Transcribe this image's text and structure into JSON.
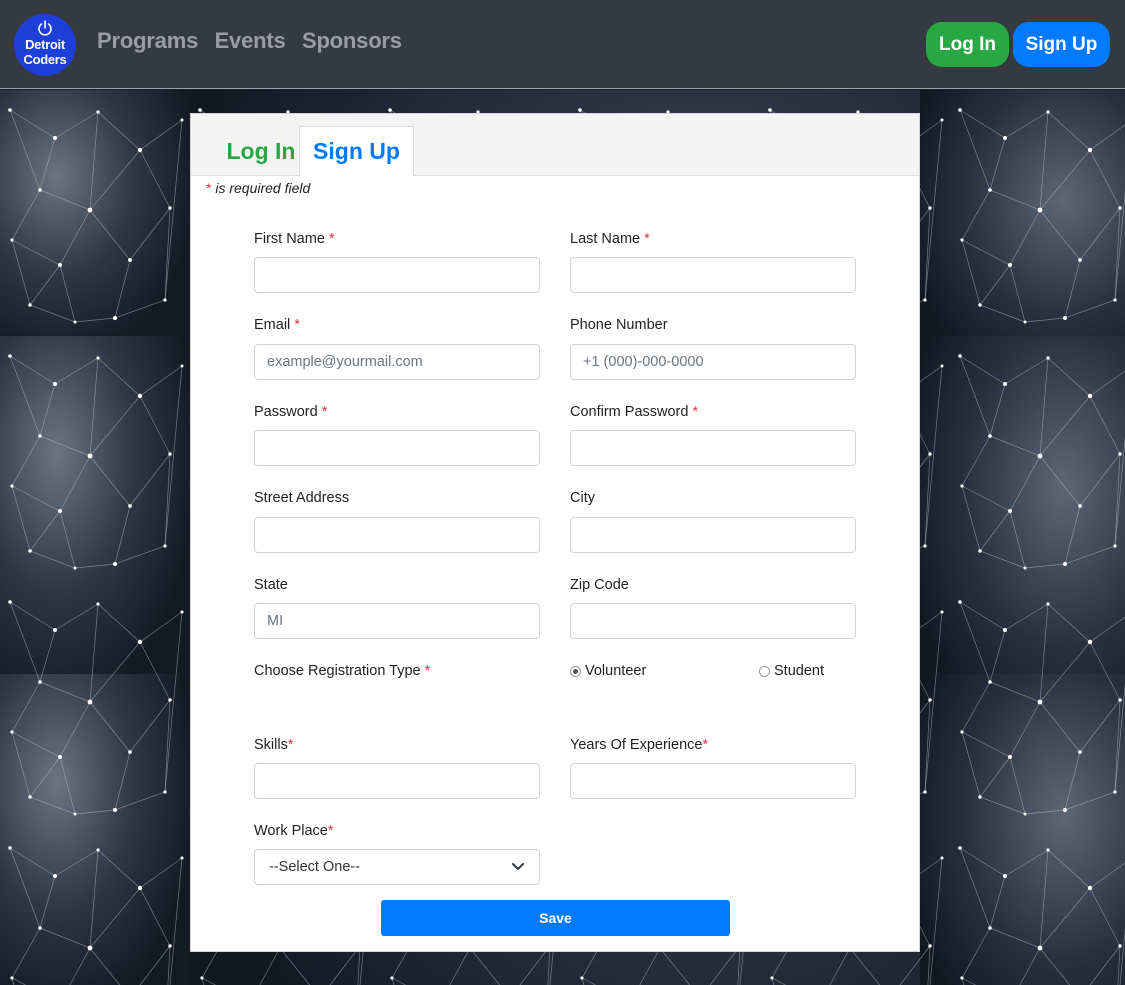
{
  "brand": {
    "line1": "Detroit",
    "line2": "Coders"
  },
  "nav": {
    "links": [
      "Programs",
      "Events",
      "Sponsors"
    ],
    "login_label": "Log In",
    "signup_label": "Sign Up"
  },
  "tabs": {
    "login": "Log In",
    "signup": "Sign Up"
  },
  "form": {
    "required_note_star": "*",
    "required_note": " is required field",
    "required_star": "*",
    "first_name": {
      "label": "First Name",
      "value": ""
    },
    "last_name": {
      "label": "Last Name",
      "value": ""
    },
    "email": {
      "label": "Email",
      "placeholder": "example@yourmail.com"
    },
    "phone": {
      "label": "Phone Number",
      "placeholder": "+1 (000)-000-0000"
    },
    "password": {
      "label": "Password"
    },
    "confirm_password": {
      "label": "Confirm Password"
    },
    "street": {
      "label": "Street Address"
    },
    "city": {
      "label": "City"
    },
    "state": {
      "label": "State",
      "placeholder": "MI"
    },
    "zip": {
      "label": "Zip Code"
    },
    "registration_type": {
      "label": "Choose Registration Type",
      "options": [
        "Volunteer",
        "Student"
      ],
      "selected": "Volunteer"
    },
    "skills": {
      "label": "Skills"
    },
    "experience": {
      "label": "Years Of Experience"
    },
    "workplace": {
      "label": "Work Place",
      "selected": "--Select One--"
    },
    "save_label": "Save"
  },
  "colors": {
    "navbar": "#343a40",
    "success": "#28a745",
    "primary": "#007bff",
    "required": "#dc3545",
    "logo": "#1e3fd6"
  }
}
